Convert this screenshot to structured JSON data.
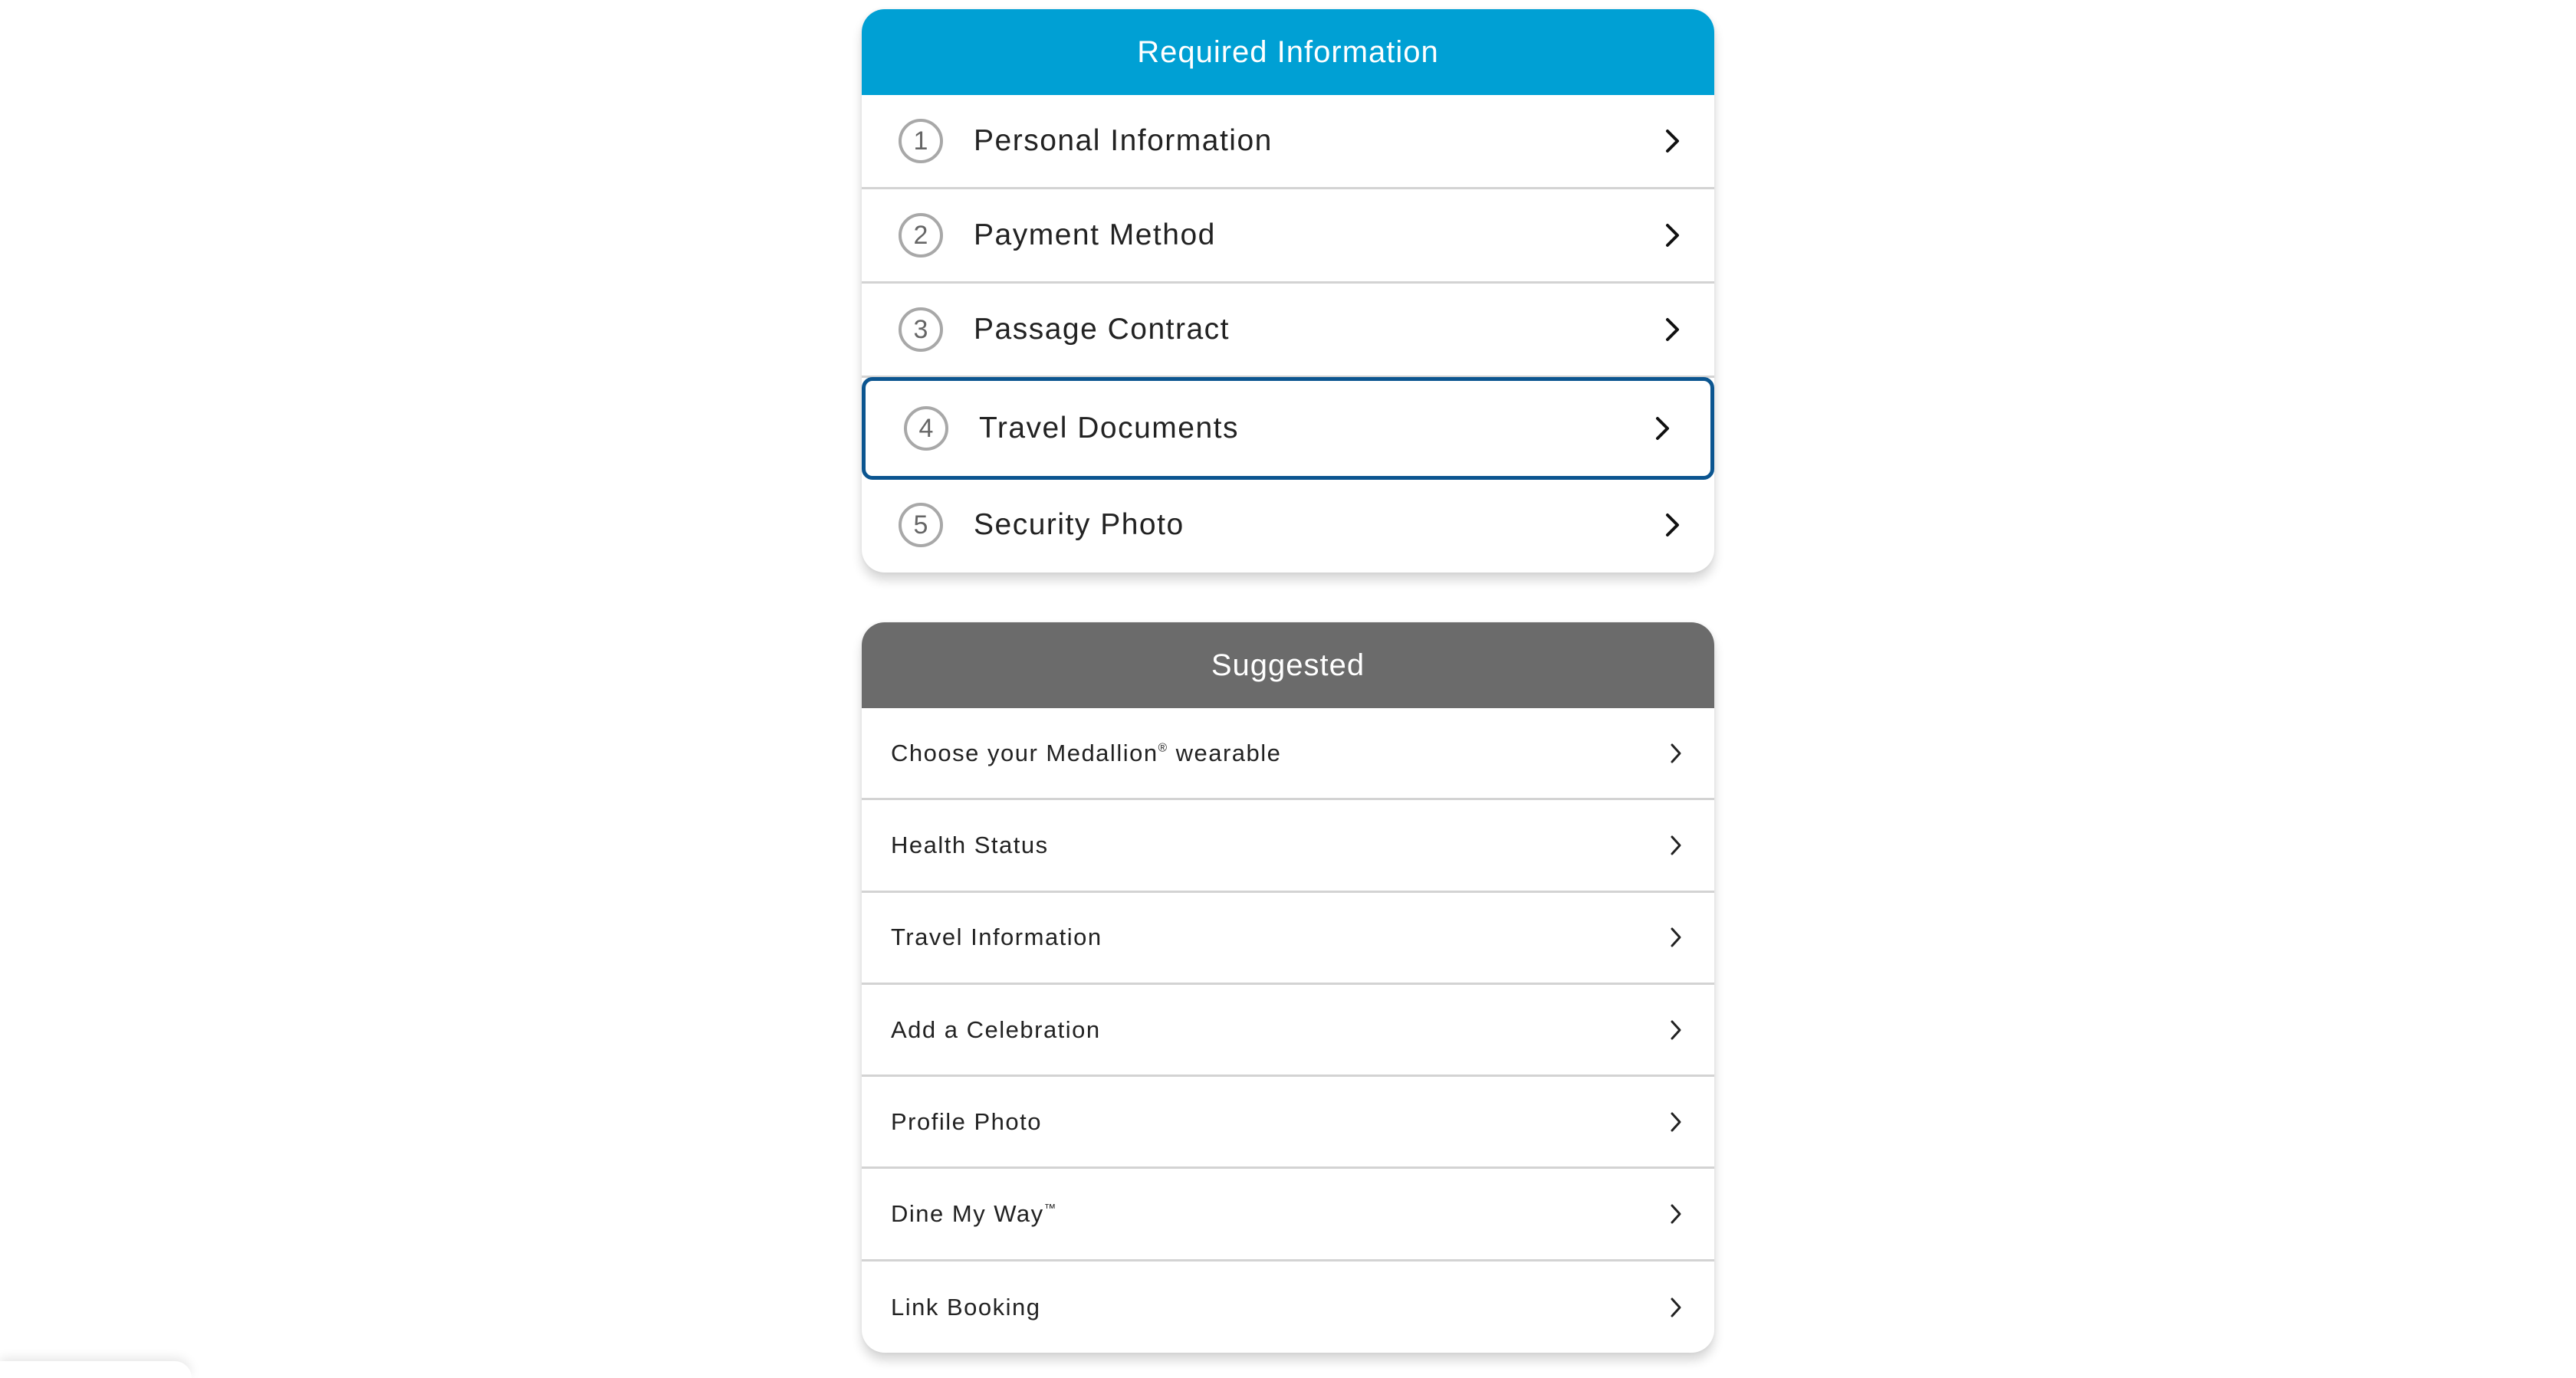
{
  "required": {
    "title": "Required Information",
    "header_color": "#00a0d4",
    "focus_color": "#0b5590",
    "items": [
      {
        "step": "1",
        "label": "Personal Information",
        "icon": "chevron-right-icon"
      },
      {
        "step": "2",
        "label": "Payment Method",
        "icon": "chevron-right-icon"
      },
      {
        "step": "3",
        "label": "Passage Contract",
        "icon": "chevron-right-icon"
      },
      {
        "step": "4",
        "label": "Travel Documents",
        "icon": "chevron-right-icon",
        "focused": true
      },
      {
        "step": "5",
        "label": "Security Photo",
        "icon": "chevron-right-icon"
      }
    ]
  },
  "suggested": {
    "title": "Suggested",
    "header_color": "#6b6b6b",
    "items": [
      {
        "label": "Choose your Medallion",
        "mark": "®",
        "label_suffix": " wearable",
        "icon": "chevron-right-icon"
      },
      {
        "label": "Health Status",
        "icon": "chevron-right-icon"
      },
      {
        "label": "Travel Information",
        "icon": "chevron-right-icon"
      },
      {
        "label": "Add a Celebration",
        "icon": "chevron-right-icon"
      },
      {
        "label": "Profile Photo",
        "icon": "chevron-right-icon"
      },
      {
        "label": "Dine My Way",
        "mark": "™",
        "icon": "chevron-right-icon"
      },
      {
        "label": "Link Booking",
        "icon": "chevron-right-icon"
      }
    ]
  }
}
